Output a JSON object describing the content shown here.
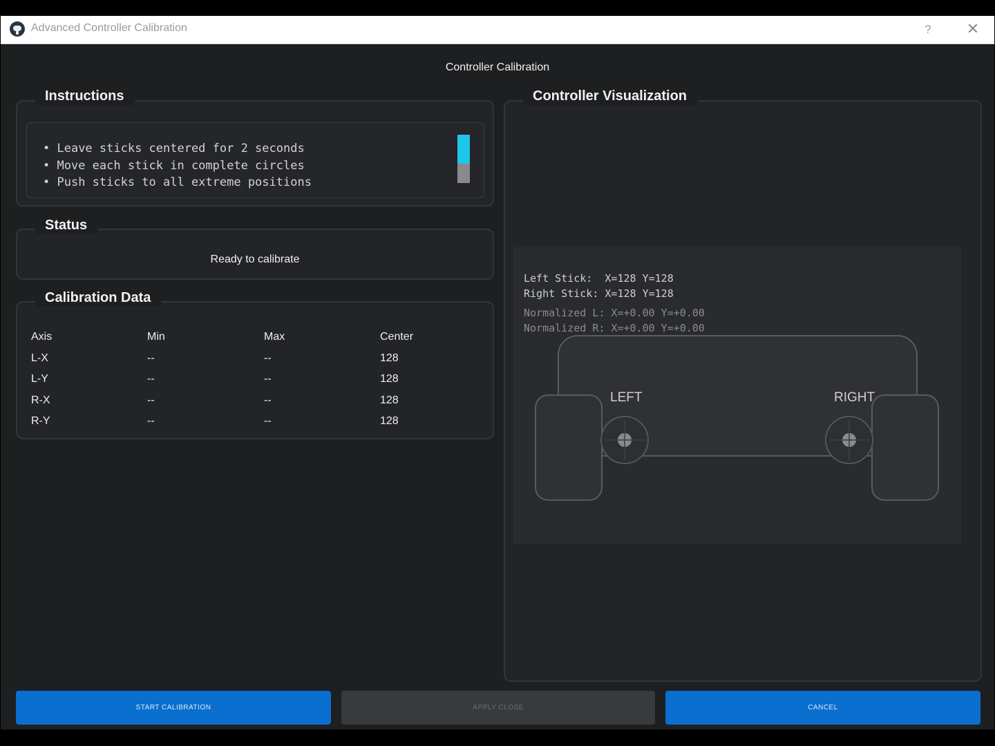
{
  "window": {
    "title": "Advanced Controller Calibration",
    "help_label": "?",
    "close_label": "✕"
  },
  "header": {
    "title": "Controller Calibration"
  },
  "instructions": {
    "title": "Instructions",
    "items": [
      "Leave sticks centered for 2 seconds",
      "Move each stick in complete circles",
      "Push sticks to all extreme positions"
    ]
  },
  "status": {
    "title": "Status",
    "text": "Ready to calibrate"
  },
  "calibration": {
    "title": "Calibration Data",
    "headers": [
      "Axis",
      "Min",
      "Max",
      "Center"
    ],
    "rows": [
      [
        "L-X",
        "--",
        "--",
        "128"
      ],
      [
        "L-Y",
        "--",
        "--",
        "128"
      ],
      [
        "R-X",
        "--",
        "--",
        "128"
      ],
      [
        "R-Y",
        "--",
        "--",
        "128"
      ]
    ]
  },
  "visualization": {
    "title": "Controller Visualization",
    "left_stick": "Left Stick:  X=128 Y=128",
    "right_stick": "Right Stick: X=128 Y=128",
    "normalized_l": "Normalized L: X=+0.00 Y=+0.00",
    "normalized_r": "Normalized R: X=+0.00 Y=+0.00",
    "left_label": "LEFT",
    "right_label": "RIGHT"
  },
  "buttons": {
    "start": "START CALIBRATION",
    "apply": "APPLY  CLOSE",
    "cancel": "CANCEL"
  },
  "colors": {
    "accent": "#0a6fcf",
    "scroll_thumb": "#1ec6ea",
    "background": "#1e1f21"
  }
}
